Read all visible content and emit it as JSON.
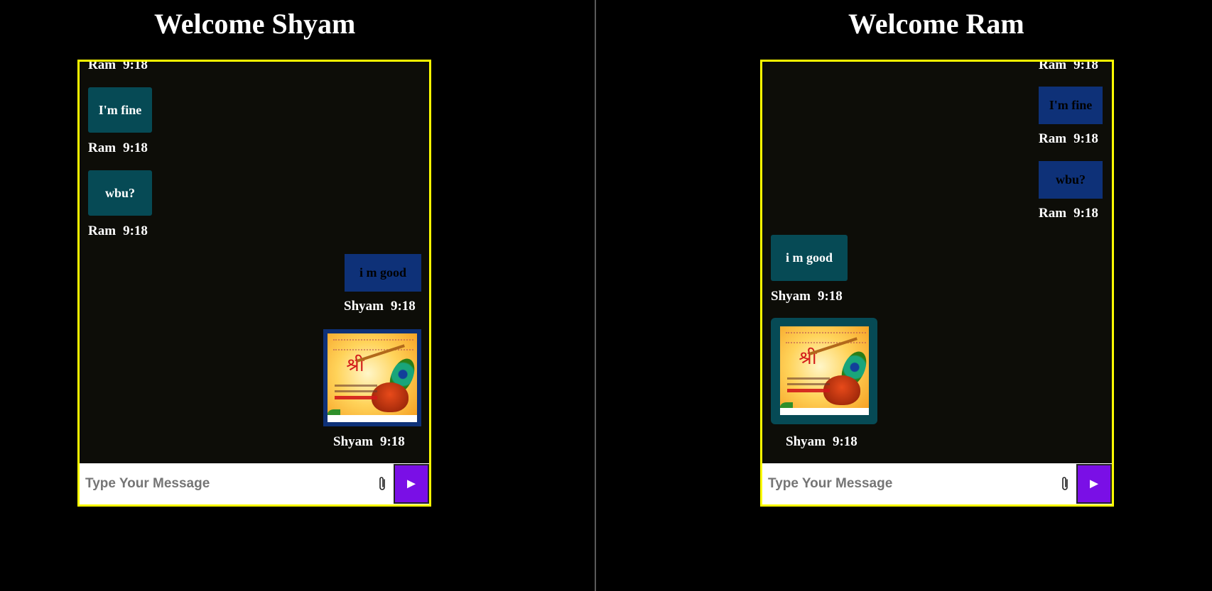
{
  "left": {
    "title": "Welcome Shyam",
    "messages": [
      {
        "text": "",
        "sender": "Ram",
        "time": "9:18"
      },
      {
        "text": "I'm fine",
        "sender": "Ram",
        "time": "9:18"
      },
      {
        "text": "wbu?",
        "sender": "Ram",
        "time": "9:18"
      },
      {
        "text": "i m good",
        "sender": "Shyam",
        "time": "9:18"
      },
      {
        "image": "janmashtami-greeting-image",
        "sender": "Shyam",
        "time": "9:18"
      }
    ],
    "input": {
      "placeholder": "Type Your Message",
      "value": ""
    }
  },
  "right": {
    "title": "Welcome Ram",
    "messages": [
      {
        "text": "",
        "sender": "Ram",
        "time": "9:18"
      },
      {
        "text": "I'm fine",
        "sender": "Ram",
        "time": "9:18"
      },
      {
        "text": "wbu?",
        "sender": "Ram",
        "time": "9:18"
      },
      {
        "text": "i m good",
        "sender": "Shyam",
        "time": "9:18"
      },
      {
        "image": "janmashtami-greeting-image",
        "sender": "Shyam",
        "time": "9:18"
      }
    ],
    "input": {
      "placeholder": "Type Your Message",
      "value": ""
    }
  },
  "icons": {
    "attach": "paperclip-icon",
    "send": "play-arrow-icon"
  },
  "send_label": "►",
  "colors": {
    "border": "#ffff00",
    "received_bubble": "#064a55",
    "sent_bubble": "#0e3178",
    "send_button": "#7a0fe6",
    "chat_background": "#0d0d08"
  }
}
